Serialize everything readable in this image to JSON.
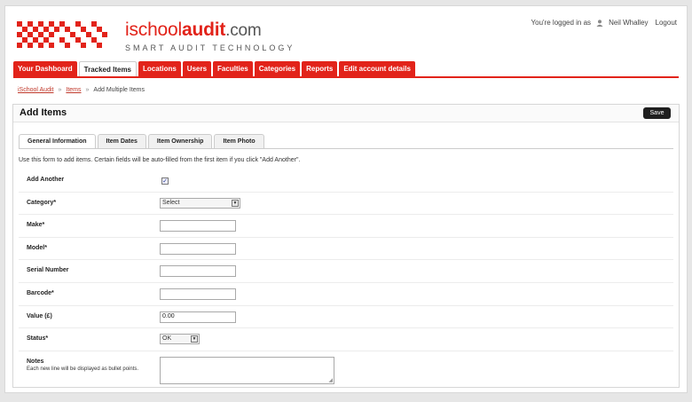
{
  "brand": {
    "name_prefix": "ischool",
    "name_suffix": "audit",
    "name_domain": ".com",
    "tagline": "SMART AUDIT TECHNOLOGY",
    "accent": "#e2231a"
  },
  "userbar": {
    "logged_in_as": "You're logged in as",
    "user_name": "Neil Whalley",
    "logout": "Logout",
    "user_icon": "user-icon"
  },
  "nav": [
    {
      "label": "Your Dashboard",
      "active": false
    },
    {
      "label": "Tracked Items",
      "active": true
    },
    {
      "label": "Locations",
      "active": false
    },
    {
      "label": "Users",
      "active": false
    },
    {
      "label": "Faculties",
      "active": false
    },
    {
      "label": "Categories",
      "active": false
    },
    {
      "label": "Reports",
      "active": false
    },
    {
      "label": "Edit account details",
      "active": false
    }
  ],
  "breadcrumb": {
    "root": "iSchool Audit",
    "sep1": "»",
    "items": "Items",
    "sep2": "»",
    "current": "Add Multiple Items"
  },
  "panel": {
    "title": "Add Items",
    "save_label": "Save",
    "tabs": [
      "General Information",
      "Item Dates",
      "Item Ownership",
      "Item Photo"
    ],
    "intro": "Use this form to add items. Certain fields will be auto-filled from the first item if you click \"Add Another\"."
  },
  "form": {
    "add_another": {
      "label": "Add Another",
      "checked": "✓"
    },
    "category": {
      "label": "Category*",
      "value": "Select"
    },
    "make": {
      "label": "Make*",
      "value": ""
    },
    "model": {
      "label": "Model*",
      "value": ""
    },
    "serial": {
      "label": "Serial Number",
      "value": ""
    },
    "barcode": {
      "label": "Barcode*",
      "value": ""
    },
    "value": {
      "label": "Value (£)",
      "value": "0.00"
    },
    "status": {
      "label": "Status*",
      "value": "OK"
    },
    "notes": {
      "label": "Notes",
      "help": "Each new line will be displayed as bullet points.",
      "value": ""
    }
  }
}
